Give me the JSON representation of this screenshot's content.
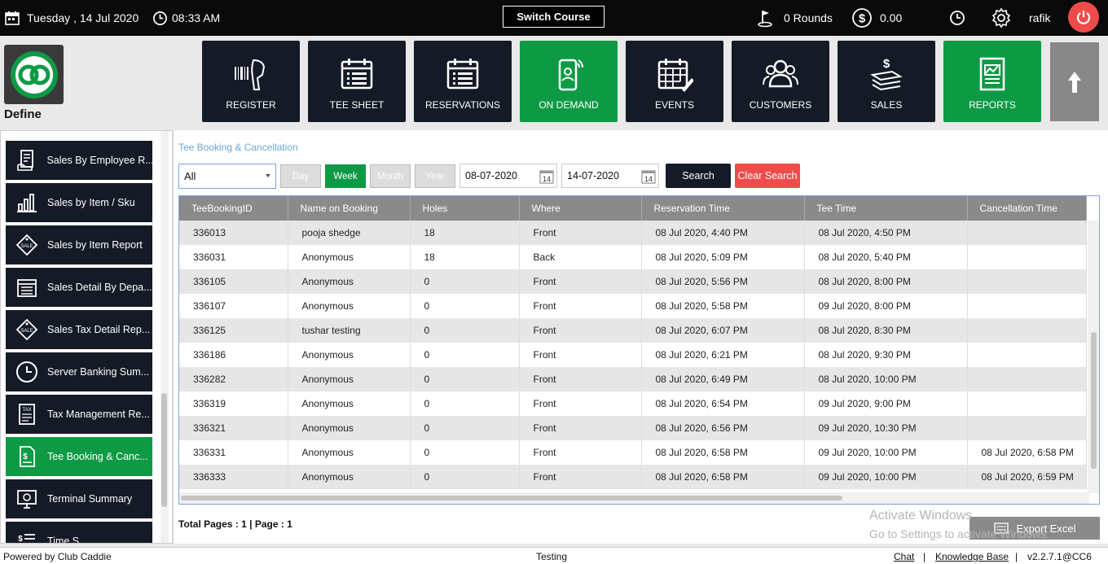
{
  "topbar": {
    "date": "Tuesday ,  14 Jul 2020",
    "time": "08:33 AM",
    "switch_course": "Switch Course",
    "rounds": "0 Rounds",
    "amount": "0.00",
    "user": "rafik"
  },
  "brand": {
    "define": "Define"
  },
  "nav": [
    {
      "label": "REGISTER",
      "icon": "barcode-scanner-icon"
    },
    {
      "label": "TEE SHEET",
      "icon": "calendar-list-icon"
    },
    {
      "label": "RESERVATIONS",
      "icon": "calendar-list-icon"
    },
    {
      "label": "ON DEMAND",
      "icon": "mobile-icon"
    },
    {
      "label": "EVENTS",
      "icon": "calendar-edit-icon"
    },
    {
      "label": "CUSTOMERS",
      "icon": "users-icon"
    },
    {
      "label": "SALES",
      "icon": "money-stack-icon"
    },
    {
      "label": "REPORTS",
      "icon": "report-chart-icon"
    }
  ],
  "sidebar": {
    "items": [
      {
        "label": "Sales By Employee R...",
        "icon": "receipt-hand-icon"
      },
      {
        "label": "Sales by Item / Sku",
        "icon": "bar-chart-icon"
      },
      {
        "label": "Sales by Item Report",
        "icon": "sale-tag-icon"
      },
      {
        "label": "Sales Detail By Depa...",
        "icon": "calendar-list-icon"
      },
      {
        "label": "Sales Tax Detail Rep...",
        "icon": "sale-tag-icon"
      },
      {
        "label": "Server Banking Sum...",
        "icon": "clock-icon"
      },
      {
        "label": "Tax Management Re...",
        "icon": "tax-doc-icon"
      },
      {
        "label": "Tee Booking & Canc...",
        "icon": "doc-dollar-icon"
      },
      {
        "label": "Terminal Summary",
        "icon": "monitor-icon"
      },
      {
        "label": "Time S...",
        "icon": "list-dollar-icon"
      }
    ],
    "active_index": 7
  },
  "main": {
    "breadcrumb": "Tee Booking & Cancellation",
    "filter_value": "All",
    "period_buttons": [
      "Day",
      "Week",
      "Month",
      "Year"
    ],
    "active_period": "Week",
    "from_date": "08-07-2020",
    "to_date": "14-07-2020",
    "search_label": "Search",
    "clear_label": "Clear Search",
    "calendar_day": "14",
    "columns": [
      "TeeBookingID",
      "Name on Booking",
      "Holes",
      "Where",
      "Reservation Time",
      "Tee Time",
      "Cancellation Time"
    ],
    "rows": [
      [
        "336013",
        "pooja shedge",
        "18",
        "Front",
        "08 Jul 2020, 4:40 PM",
        "08 Jul 2020, 4:50 PM",
        ""
      ],
      [
        "336031",
        "Anonymous",
        "18",
        "Back",
        "08 Jul 2020, 5:09 PM",
        "08 Jul 2020, 5:40 PM",
        ""
      ],
      [
        "336105",
        "Anonymous",
        "0",
        "Front",
        "08 Jul 2020, 5:56 PM",
        "08 Jul 2020, 8:00 PM",
        ""
      ],
      [
        "336107",
        "Anonymous",
        "0",
        "Front",
        "08 Jul 2020, 5:58 PM",
        "09 Jul 2020, 8:00 PM",
        ""
      ],
      [
        "336125",
        "tushar testing",
        "0",
        "Front",
        "08 Jul 2020, 6:07 PM",
        "08 Jul 2020, 8:30 PM",
        ""
      ],
      [
        "336186",
        "Anonymous",
        "0",
        "Front",
        "08 Jul 2020, 6:21 PM",
        "08 Jul 2020, 9:30 PM",
        ""
      ],
      [
        "336282",
        "Anonymous",
        "0",
        "Front",
        "08 Jul 2020, 6:49 PM",
        "08 Jul 2020, 10:00 PM",
        ""
      ],
      [
        "336319",
        "Anonymous",
        "0",
        "Front",
        "08 Jul 2020, 6:54 PM",
        "09 Jul 2020, 9:00 PM",
        ""
      ],
      [
        "336321",
        "Anonymous",
        "0",
        "Front",
        "08 Jul 2020, 6:56 PM",
        "09 Jul 2020, 10:30 PM",
        ""
      ],
      [
        "336331",
        "Anonymous",
        "0",
        "Front",
        "08 Jul 2020, 6:58 PM",
        "09 Jul 2020, 10:00 PM",
        "08 Jul 2020, 6:58 PM"
      ],
      [
        "336333",
        "Anonymous",
        "0",
        "Front",
        "08 Jul 2020, 6:58 PM",
        "09 Jul 2020, 10:00 PM",
        "08 Jul 2020, 6:59 PM"
      ]
    ],
    "pagination": "Total Pages : 1 | Page : 1",
    "export_label": "Export Excel",
    "watermark_title": "Activate Windows",
    "watermark_sub": "Go to Settings to activate Windows."
  },
  "footer": {
    "powered": "Powered by Club Caddie",
    "env": "Testing",
    "chat": "Chat",
    "sep": "|",
    "kb": "Knowledge Base",
    "version": "v2.2.7.1@CC6"
  },
  "colors": {
    "green": "#0e9a45",
    "navy": "#141a26",
    "red": "#ef4b4b",
    "header_gray": "#8a8a8a",
    "link_blue": "#6aa7d6"
  }
}
